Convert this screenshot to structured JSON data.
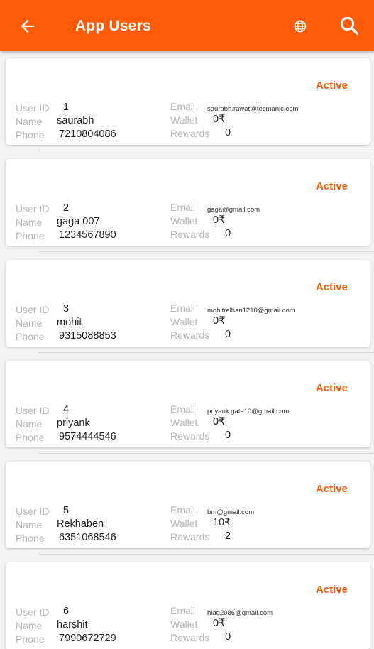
{
  "header": {
    "title": "App Users",
    "back_icon": "arrow-left-icon",
    "language_icon": "globe-icon",
    "search_icon": "search-icon",
    "bar_color": "#ff5a05"
  },
  "labels": {
    "user_id": "User ID",
    "name": "Name",
    "phone": "Phone",
    "email": "Email",
    "wallet": "Wallet",
    "rewards": "Rewards"
  },
  "users": [
    {
      "status": "Active",
      "id": "1",
      "name": "saurabh",
      "phone": "7210804086",
      "email": "saurabh.rawat@tecmanic.com",
      "wallet": "0₹",
      "rewards": "0"
    },
    {
      "status": "Active",
      "id": "2",
      "name": "gaga 007",
      "phone": "1234567890",
      "email": "gaga@gmail.com",
      "wallet": "0₹",
      "rewards": "0"
    },
    {
      "status": "Active",
      "id": "3",
      "name": "mohit",
      "phone": "9315088853",
      "email": "mohitrelhan1210@gmail.com",
      "wallet": "0₹",
      "rewards": "0"
    },
    {
      "status": "Active",
      "id": "4",
      "name": "priyank",
      "phone": "9574444546",
      "email": "priyank.gate10@gmail.com",
      "wallet": "0₹",
      "rewards": "0"
    },
    {
      "status": "Active",
      "id": "5",
      "name": "Rekhaben",
      "phone": "6351068546",
      "email": "bm@gmail.com",
      "wallet": "10₹",
      "rewards": "2"
    },
    {
      "status": "Active",
      "id": "6",
      "name": "harshit",
      "phone": "7990672729",
      "email": "hlad2086@gmail.com",
      "wallet": "0₹",
      "rewards": "0"
    }
  ]
}
